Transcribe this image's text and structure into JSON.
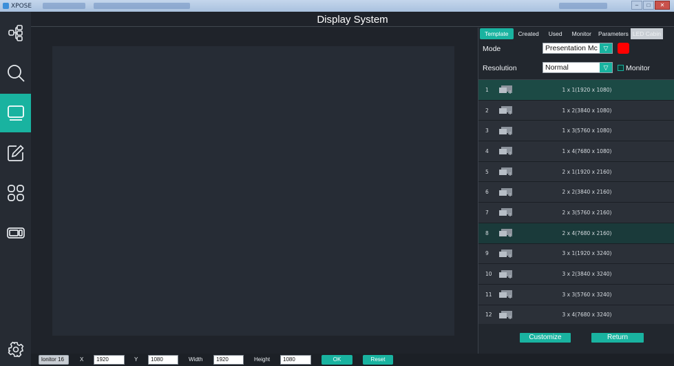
{
  "os_window": {
    "app_name": "XPOSE",
    "controls": {
      "minimize": "–",
      "maximize": "□",
      "close": "✕"
    }
  },
  "header": {
    "title": "Display System"
  },
  "sidebar": {
    "items": [
      {
        "icon": "network-icon"
      },
      {
        "icon": "search-icon"
      },
      {
        "icon": "screen-icon",
        "active": true
      },
      {
        "icon": "edit-icon"
      },
      {
        "icon": "grid-icon"
      },
      {
        "icon": "card-icon"
      },
      {
        "icon": "settings-icon"
      }
    ]
  },
  "right_panel": {
    "tabs": [
      {
        "label": "Template",
        "active": true
      },
      {
        "label": "Created"
      },
      {
        "label": "Used"
      },
      {
        "label": "Monitor"
      },
      {
        "label": "Parameters"
      },
      {
        "label": "LED Cabin"
      }
    ],
    "mode": {
      "label": "Mode",
      "value": "Presentation Mc",
      "color": "#ff0000"
    },
    "resolution": {
      "label": "Resolution",
      "value": "Normal",
      "monitor_label": "Monitor"
    },
    "templates": [
      {
        "num": "1",
        "label": "1 x 1(1920 x 1080)"
      },
      {
        "num": "2",
        "label": "1 x 2(3840 x 1080)"
      },
      {
        "num": "3",
        "label": "1 x 3(5760 x 1080)"
      },
      {
        "num": "4",
        "label": "1 x 4(7680 x 1080)"
      },
      {
        "num": "5",
        "label": "2 x 1(1920 x 2160)"
      },
      {
        "num": "6",
        "label": "2 x 2(3840 x 2160)"
      },
      {
        "num": "7",
        "label": "2 x 3(5760 x 2160)"
      },
      {
        "num": "8",
        "label": "2 x 4(7680 x 2160)"
      },
      {
        "num": "9",
        "label": "3 x 1(1920 x 3240)"
      },
      {
        "num": "10",
        "label": "3 x 2(3840 x 3240)"
      },
      {
        "num": "11",
        "label": "3 x 3(5760 x 3240)"
      },
      {
        "num": "12",
        "label": "3 x 4(7680 x 3240)"
      }
    ],
    "customize_label": "Customize",
    "return_label": "Return"
  },
  "bottom_bar": {
    "monitor_value": "lonitor 16",
    "x_label": "X",
    "x_value": "1920",
    "y_label": "Y",
    "y_value": "1080",
    "width_label": "Width",
    "width_value": "1920",
    "height_label": "Height",
    "height_value": "1080",
    "ok_label": "OK",
    "reset_label": "Reset"
  },
  "colors": {
    "accent": "#19b3a0",
    "background": "#1f232a",
    "canvas": "#262c35"
  }
}
